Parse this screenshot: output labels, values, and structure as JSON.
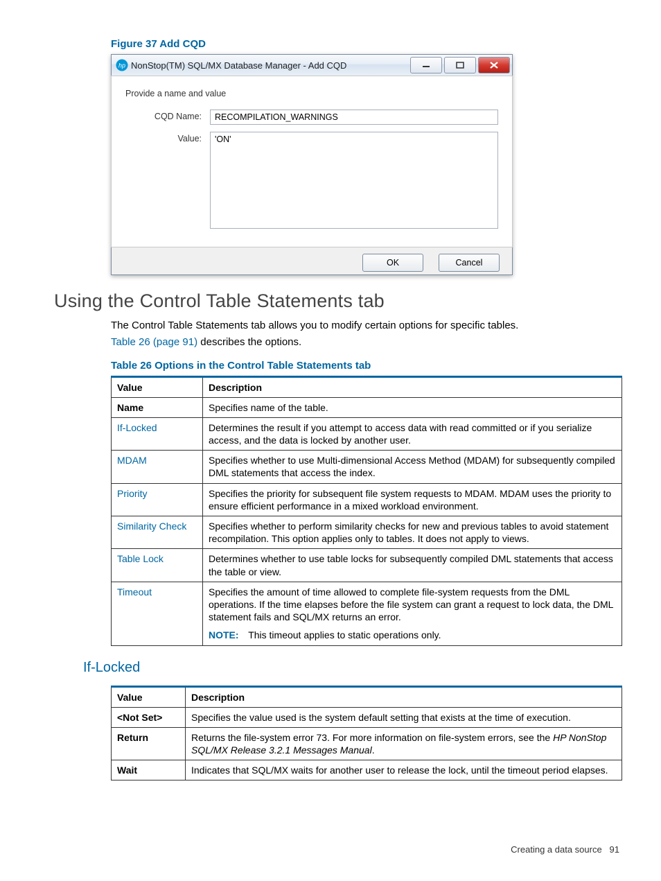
{
  "figure": {
    "caption": "Figure 37 Add CQD",
    "dialog": {
      "title": "NonStop(TM) SQL/MX Database Manager - Add CQD",
      "subtitle": "Provide a name and value",
      "labels": {
        "cqd_name": "CQD Name:",
        "value": "Value:"
      },
      "values": {
        "cqd_name": "RECOMPILATION_WARNINGS",
        "value": "'ON'"
      },
      "buttons": {
        "ok": "OK",
        "cancel": "Cancel"
      }
    }
  },
  "section_title": "Using the Control Table Statements tab",
  "intro_text": "The Control Table Statements tab allows you to modify certain options for specific tables.",
  "intro_link_text": "Table 26 (page 91)",
  "intro_tail": " describes the options.",
  "table26": {
    "caption": "Table 26 Options in the Control Table Statements tab",
    "head": {
      "c1": "Value",
      "c2": "Description"
    },
    "rows": [
      {
        "name": "Name",
        "link": false,
        "bold": true,
        "desc": "Specifies name of the table."
      },
      {
        "name": "If-Locked",
        "link": true,
        "desc": "Determines the result if you attempt to access data with read committed or if you serialize access, and the data is locked by another user."
      },
      {
        "name": "MDAM",
        "link": true,
        "desc": "Specifies whether to use Multi-dimensional Access Method (MDAM) for subsequently compiled DML statements that access the index."
      },
      {
        "name": "Priority",
        "link": true,
        "desc": "Specifies the priority for subsequent file system requests to MDAM. MDAM uses the priority to ensure efficient performance in a mixed workload environment."
      },
      {
        "name": "Similarity Check",
        "link": true,
        "desc": "Specifies whether to perform similarity checks for new and previous tables to avoid statement recompilation. This option applies only to tables. It does not apply to views."
      },
      {
        "name": "Table Lock",
        "link": true,
        "desc": "Determines whether to use table locks for subsequently compiled DML statements that access the table or view."
      },
      {
        "name": "Timeout",
        "link": true,
        "desc": "Specifies the amount of time allowed to complete file-system requests from the DML operations. If the time elapses before the file system can grant a request to lock data, the DML statement fails and SQL/MX returns an error.",
        "note_label": "NOTE:",
        "note_text": "This timeout applies to static operations only."
      }
    ]
  },
  "subsection_title": "If-Locked",
  "iflocked_table": {
    "head": {
      "c1": "Value",
      "c2": "Description"
    },
    "rows": [
      {
        "name": "<Not Set>",
        "desc": "Specifies the value used is the system default setting that exists at the time of execution."
      },
      {
        "name": "Return",
        "desc_pre": "Returns the file-system error 73. For more information on file-system errors, see the ",
        "desc_italic": "HP NonStop SQL/MX Release 3.2.1 Messages Manual",
        "desc_post": "."
      },
      {
        "name": "Wait",
        "desc": "Indicates that SQL/MX waits for another user to release the lock, until the timeout period elapses."
      }
    ]
  },
  "footer": {
    "text": "Creating a data source",
    "page": "91"
  }
}
